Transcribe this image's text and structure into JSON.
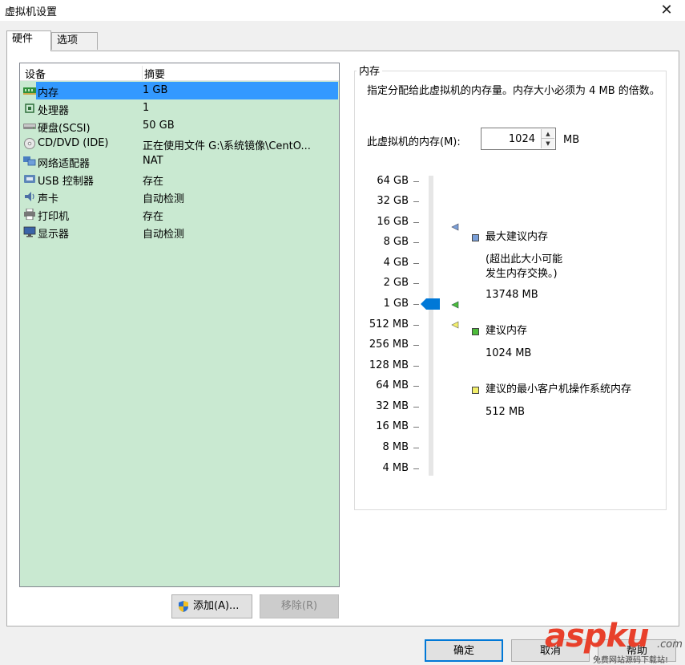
{
  "window": {
    "title": "虚拟机设置",
    "close_glyph": "✕"
  },
  "tabs": [
    {
      "label": "硬件"
    },
    {
      "label": "选项"
    }
  ],
  "device_list": {
    "columns": [
      "设备",
      "摘要"
    ],
    "rows": [
      {
        "icon": "memory-icon",
        "name": "内存",
        "summary": "1 GB"
      },
      {
        "icon": "processor-icon",
        "name": "处理器",
        "summary": "1"
      },
      {
        "icon": "hard-disk-icon",
        "name": "硬盘(SCSI)",
        "summary": "50 GB"
      },
      {
        "icon": "cd-dvd-icon",
        "name": "CD/DVD (IDE)",
        "summary": "正在使用文件 G:\\系统镜像\\CentO..."
      },
      {
        "icon": "network-adapter-icon",
        "name": "网络适配器",
        "summary": "NAT"
      },
      {
        "icon": "usb-controller-icon",
        "name": "USB 控制器",
        "summary": "存在"
      },
      {
        "icon": "sound-card-icon",
        "name": "声卡",
        "summary": "自动检测"
      },
      {
        "icon": "printer-icon",
        "name": "打印机",
        "summary": "存在"
      },
      {
        "icon": "display-icon",
        "name": "显示器",
        "summary": "自动检测"
      }
    ]
  },
  "buttons": {
    "add": "添加(A)...",
    "remove": "移除(R)"
  },
  "memory": {
    "group_title": "内存",
    "description": "指定分配给此虚拟机的内存量。内存大小必须为 4 MB 的倍数。",
    "field_label": "此虚拟机的内存(M):",
    "value": "1024",
    "unit": "MB",
    "scale": [
      "64 GB",
      "32 GB",
      "16 GB",
      "8 GB",
      "4 GB",
      "2 GB",
      "1 GB",
      "512 MB",
      "256 MB",
      "128 MB",
      "64 MB",
      "32 MB",
      "16 MB",
      "8 MB",
      "4 MB"
    ],
    "legend": {
      "max": {
        "label": "最大建议内存",
        "note_line1": "(超出此大小可能",
        "note_line2": "发生内存交换。)",
        "value": "13748 MB",
        "color": "#7a9fd8"
      },
      "recommended": {
        "label": "建议内存",
        "value": "1024 MB",
        "color": "#4dbb3a"
      },
      "min_guest": {
        "label": "建议的最小客户机操作系统内存",
        "value": "512 MB",
        "color": "#f2ee6a"
      }
    },
    "thumb_color": "#0078d7"
  },
  "dialog_buttons": {
    "ok": "确定",
    "cancel": "取消",
    "help": "帮助"
  },
  "watermark": {
    "main": "aspku",
    "com": ".com",
    "sub": "免费网站源码下载站!"
  }
}
